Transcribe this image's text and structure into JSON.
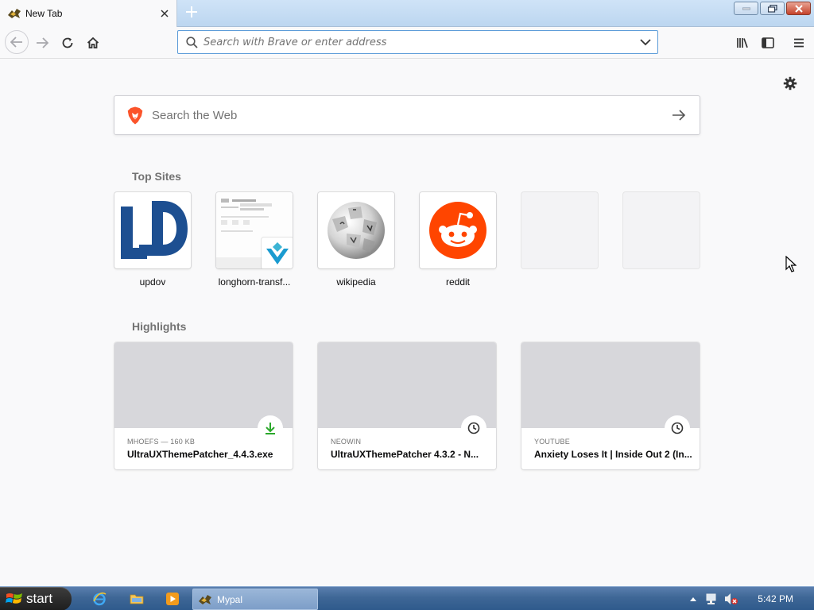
{
  "tab": {
    "title": "New Tab"
  },
  "urlbar": {
    "placeholder": "Search with Brave or enter address"
  },
  "search": {
    "placeholder": "Search the Web"
  },
  "top_sites": {
    "heading": "Top Sites",
    "items": [
      {
        "label": "updov"
      },
      {
        "label": "longhorn-transf..."
      },
      {
        "label": "wikipedia"
      },
      {
        "label": "reddit"
      }
    ]
  },
  "highlights": {
    "heading": "Highlights",
    "items": [
      {
        "context": "MHOEFS — 160 KB",
        "title": "UltraUXThemePatcher_4.4.3.exe",
        "badge": "download-icon"
      },
      {
        "context": "NEOWIN",
        "title": "UltraUXThemePatcher 4.3.2 - N...",
        "badge": "clock-icon"
      },
      {
        "context": "YOUTUBE",
        "title": "Anxiety Loses It | Inside Out 2 (In...",
        "badge": "clock-icon"
      }
    ]
  },
  "taskbar": {
    "start_label": "start",
    "task_label": "Mypal",
    "clock": "5:42 PM"
  },
  "colors": {
    "urlbar_focus": "#5b9bd8",
    "reddit": "#ff4500",
    "updov": "#1d4f91",
    "download": "#2ba82b"
  }
}
